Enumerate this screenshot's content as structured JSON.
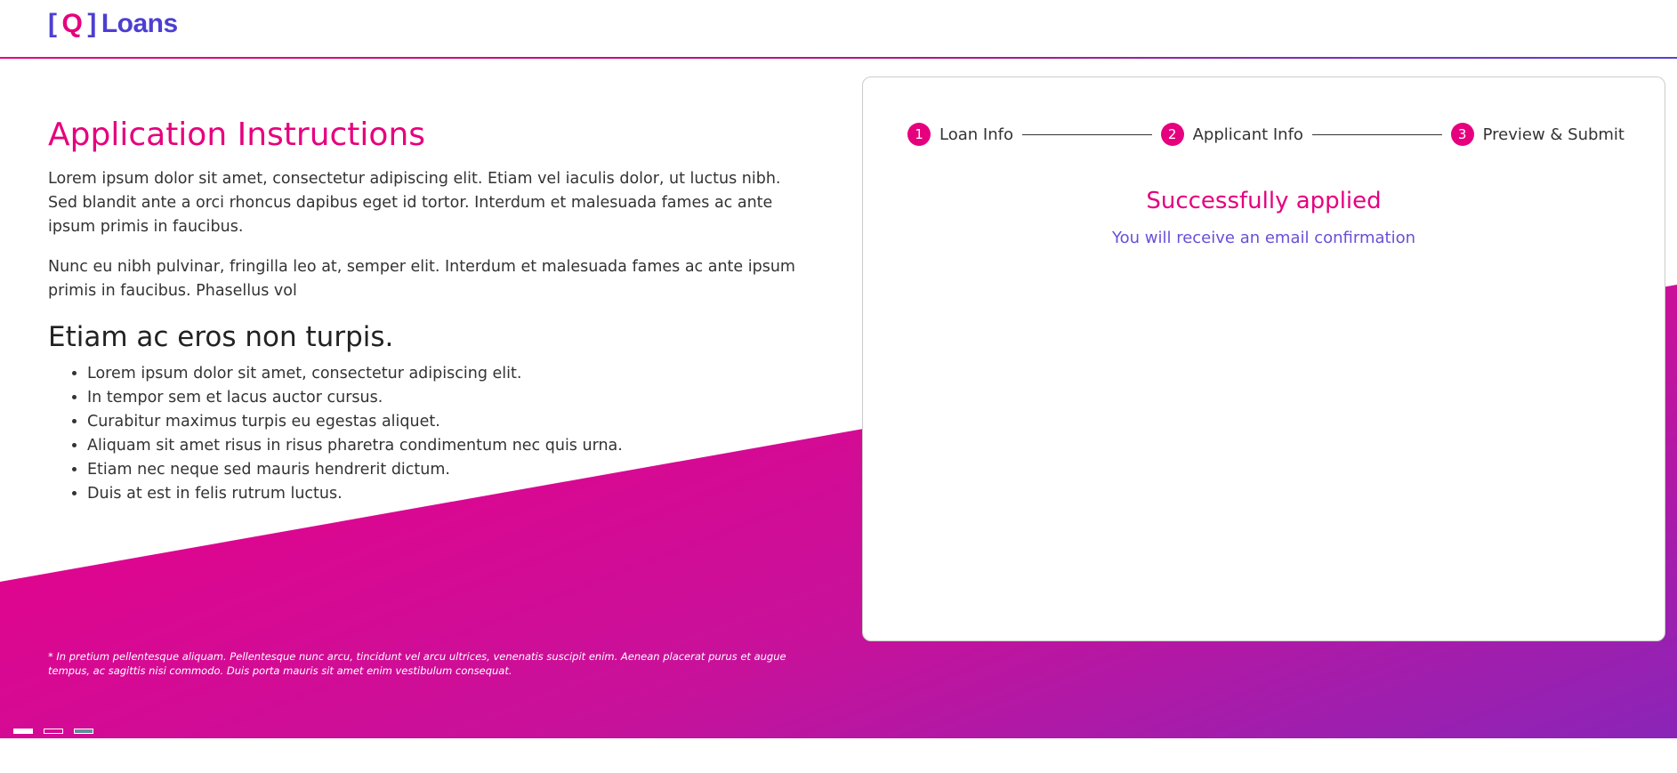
{
  "colors": {
    "brand_pink": "#e6007e",
    "brand_purple": "#4d3fd1",
    "gradient_end": "#8a25b8"
  },
  "header": {
    "logo": {
      "bracket_open": "[",
      "letter": "Q",
      "bracket_close": "]",
      "name": "Loans"
    }
  },
  "instructions": {
    "title": "Application Instructions",
    "paragraphs": [
      "Lorem ipsum dolor sit amet, consectetur adipiscing elit. Etiam vel iaculis dolor, ut luctus nibh. Sed blandit ante a orci rhoncus dapibus eget id tortor. Interdum et malesuada fames ac ante ipsum primis in faucibus.",
      "Nunc eu nibh pulvinar, fringilla leo at, semper elit. Interdum et malesuada fames ac ante ipsum primis in faucibus. Phasellus vol"
    ],
    "subtitle": "Etiam ac eros non turpis.",
    "list": [
      "Lorem ipsum dolor sit amet, consectetur adipiscing elit.",
      "In tempor sem et lacus auctor cursus.",
      "Curabitur maximus turpis eu egestas aliquet.",
      "Aliquam sit amet risus in risus pharetra condimentum nec quis urna.",
      "Etiam nec neque sed mauris hendrerit dictum.",
      "Duis at est in felis rutrum luctus."
    ],
    "footnote": "* In pretium pellentesque aliquam. Pellentesque nunc arcu, tincidunt vel arcu ultrices, venenatis suscipit enim. Aenean placerat purus et augue tempus, ac sagittis nisi commodo. Duis porta mauris sit amet enim vestibulum consequat."
  },
  "stepper": {
    "steps": [
      {
        "number": "1",
        "label": "Loan Info"
      },
      {
        "number": "2",
        "label": "Applicant Info"
      },
      {
        "number": "3",
        "label": "Preview & Submit"
      }
    ]
  },
  "result": {
    "title": "Successfully applied",
    "subtitle": "You will receive an email confirmation"
  }
}
